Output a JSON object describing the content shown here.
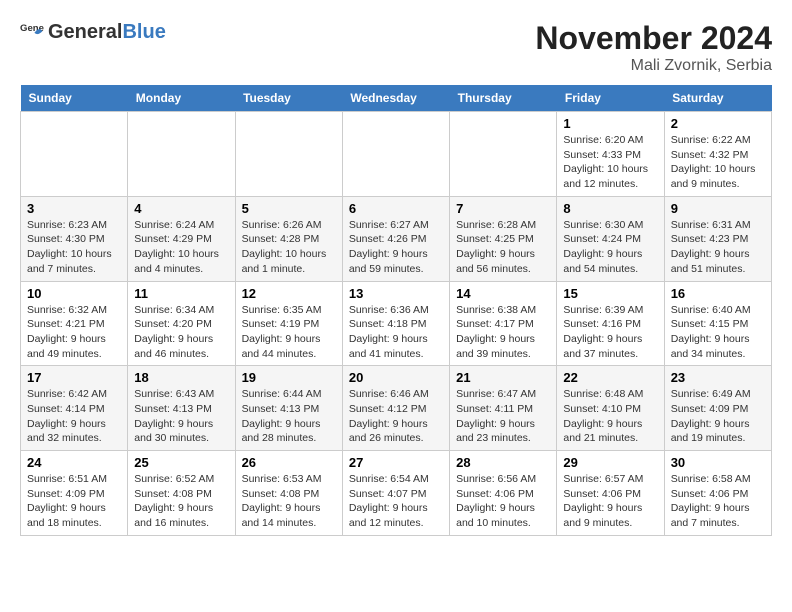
{
  "logo": {
    "text_general": "General",
    "text_blue": "Blue"
  },
  "title": "November 2024",
  "location": "Mali Zvornik, Serbia",
  "weekdays": [
    "Sunday",
    "Monday",
    "Tuesday",
    "Wednesday",
    "Thursday",
    "Friday",
    "Saturday"
  ],
  "weeks": [
    [
      {
        "day": "",
        "info": ""
      },
      {
        "day": "",
        "info": ""
      },
      {
        "day": "",
        "info": ""
      },
      {
        "day": "",
        "info": ""
      },
      {
        "day": "",
        "info": ""
      },
      {
        "day": "1",
        "info": "Sunrise: 6:20 AM\nSunset: 4:33 PM\nDaylight: 10 hours\nand 12 minutes."
      },
      {
        "day": "2",
        "info": "Sunrise: 6:22 AM\nSunset: 4:32 PM\nDaylight: 10 hours\nand 9 minutes."
      }
    ],
    [
      {
        "day": "3",
        "info": "Sunrise: 6:23 AM\nSunset: 4:30 PM\nDaylight: 10 hours\nand 7 minutes."
      },
      {
        "day": "4",
        "info": "Sunrise: 6:24 AM\nSunset: 4:29 PM\nDaylight: 10 hours\nand 4 minutes."
      },
      {
        "day": "5",
        "info": "Sunrise: 6:26 AM\nSunset: 4:28 PM\nDaylight: 10 hours\nand 1 minute."
      },
      {
        "day": "6",
        "info": "Sunrise: 6:27 AM\nSunset: 4:26 PM\nDaylight: 9 hours\nand 59 minutes."
      },
      {
        "day": "7",
        "info": "Sunrise: 6:28 AM\nSunset: 4:25 PM\nDaylight: 9 hours\nand 56 minutes."
      },
      {
        "day": "8",
        "info": "Sunrise: 6:30 AM\nSunset: 4:24 PM\nDaylight: 9 hours\nand 54 minutes."
      },
      {
        "day": "9",
        "info": "Sunrise: 6:31 AM\nSunset: 4:23 PM\nDaylight: 9 hours\nand 51 minutes."
      }
    ],
    [
      {
        "day": "10",
        "info": "Sunrise: 6:32 AM\nSunset: 4:21 PM\nDaylight: 9 hours\nand 49 minutes."
      },
      {
        "day": "11",
        "info": "Sunrise: 6:34 AM\nSunset: 4:20 PM\nDaylight: 9 hours\nand 46 minutes."
      },
      {
        "day": "12",
        "info": "Sunrise: 6:35 AM\nSunset: 4:19 PM\nDaylight: 9 hours\nand 44 minutes."
      },
      {
        "day": "13",
        "info": "Sunrise: 6:36 AM\nSunset: 4:18 PM\nDaylight: 9 hours\nand 41 minutes."
      },
      {
        "day": "14",
        "info": "Sunrise: 6:38 AM\nSunset: 4:17 PM\nDaylight: 9 hours\nand 39 minutes."
      },
      {
        "day": "15",
        "info": "Sunrise: 6:39 AM\nSunset: 4:16 PM\nDaylight: 9 hours\nand 37 minutes."
      },
      {
        "day": "16",
        "info": "Sunrise: 6:40 AM\nSunset: 4:15 PM\nDaylight: 9 hours\nand 34 minutes."
      }
    ],
    [
      {
        "day": "17",
        "info": "Sunrise: 6:42 AM\nSunset: 4:14 PM\nDaylight: 9 hours\nand 32 minutes."
      },
      {
        "day": "18",
        "info": "Sunrise: 6:43 AM\nSunset: 4:13 PM\nDaylight: 9 hours\nand 30 minutes."
      },
      {
        "day": "19",
        "info": "Sunrise: 6:44 AM\nSunset: 4:13 PM\nDaylight: 9 hours\nand 28 minutes."
      },
      {
        "day": "20",
        "info": "Sunrise: 6:46 AM\nSunset: 4:12 PM\nDaylight: 9 hours\nand 26 minutes."
      },
      {
        "day": "21",
        "info": "Sunrise: 6:47 AM\nSunset: 4:11 PM\nDaylight: 9 hours\nand 23 minutes."
      },
      {
        "day": "22",
        "info": "Sunrise: 6:48 AM\nSunset: 4:10 PM\nDaylight: 9 hours\nand 21 minutes."
      },
      {
        "day": "23",
        "info": "Sunrise: 6:49 AM\nSunset: 4:09 PM\nDaylight: 9 hours\nand 19 minutes."
      }
    ],
    [
      {
        "day": "24",
        "info": "Sunrise: 6:51 AM\nSunset: 4:09 PM\nDaylight: 9 hours\nand 18 minutes."
      },
      {
        "day": "25",
        "info": "Sunrise: 6:52 AM\nSunset: 4:08 PM\nDaylight: 9 hours\nand 16 minutes."
      },
      {
        "day": "26",
        "info": "Sunrise: 6:53 AM\nSunset: 4:08 PM\nDaylight: 9 hours\nand 14 minutes."
      },
      {
        "day": "27",
        "info": "Sunrise: 6:54 AM\nSunset: 4:07 PM\nDaylight: 9 hours\nand 12 minutes."
      },
      {
        "day": "28",
        "info": "Sunrise: 6:56 AM\nSunset: 4:06 PM\nDaylight: 9 hours\nand 10 minutes."
      },
      {
        "day": "29",
        "info": "Sunrise: 6:57 AM\nSunset: 4:06 PM\nDaylight: 9 hours\nand 9 minutes."
      },
      {
        "day": "30",
        "info": "Sunrise: 6:58 AM\nSunset: 4:06 PM\nDaylight: 9 hours\nand 7 minutes."
      }
    ]
  ]
}
